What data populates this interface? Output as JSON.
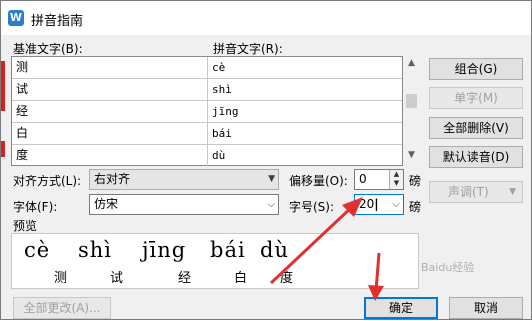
{
  "window": {
    "title": "拼音指南",
    "app_icon_letter": "W"
  },
  "grid": {
    "col_base_label": "基准文字(B):",
    "col_pinyin_label": "拼音文字(R):",
    "rows": [
      {
        "base": "测",
        "pinyin": "cè"
      },
      {
        "base": "试",
        "pinyin": "shì"
      },
      {
        "base": "经",
        "pinyin": "jīng"
      },
      {
        "base": "白",
        "pinyin": "bái"
      },
      {
        "base": "度",
        "pinyin": "dù"
      }
    ]
  },
  "side_buttons": {
    "combine": "组合(G)",
    "single_char": "单字(M)",
    "delete_all": "全部删除(V)",
    "default_reading": "默认读音(D)",
    "tone": "声调(T)"
  },
  "options": {
    "align_label": "对齐方式(L):",
    "align_value": "右对齐",
    "offset_label": "偏移量(O):",
    "offset_value": "0",
    "offset_unit": "磅",
    "font_label": "字体(F):",
    "font_value": "仿宋",
    "size_label": "字号(S):",
    "size_value": "20",
    "size_unit": "磅"
  },
  "preview": {
    "label": "预览",
    "pinyin": [
      "cè",
      "shì",
      "jīng",
      "bái",
      "dù"
    ],
    "hanzi": [
      "测",
      "试",
      "经",
      "白",
      "度"
    ]
  },
  "footer": {
    "change_all": "全部更改(A)...",
    "ok": "确定",
    "cancel": "取消"
  },
  "watermark": "Baidu经验",
  "colors": {
    "annotation_arrow": "#e03030",
    "default_button_border": "#0078d7"
  },
  "icons": [
    "dropdown-icon",
    "spin-up-icon",
    "spin-down-icon",
    "scroll-up-icon",
    "scroll-down-icon"
  ]
}
